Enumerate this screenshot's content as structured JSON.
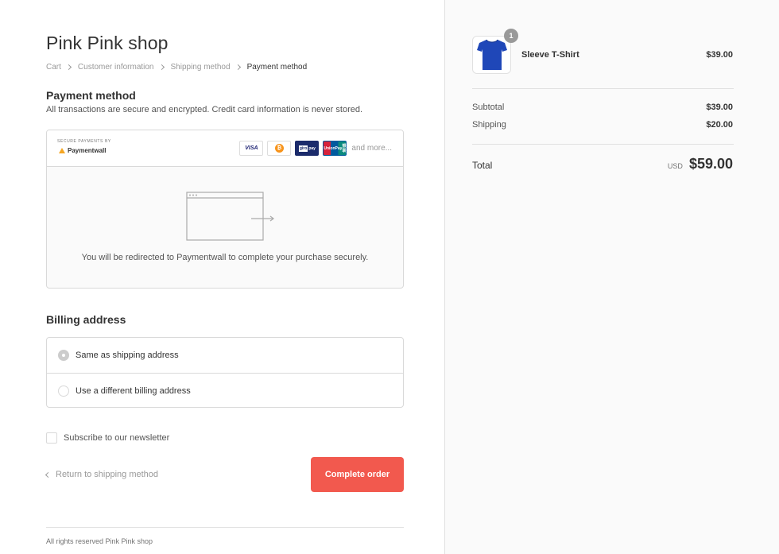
{
  "shop": {
    "title": "Pink Pink shop"
  },
  "breadcrumb": {
    "items": [
      "Cart",
      "Customer information",
      "Shipping method",
      "Payment method"
    ]
  },
  "payment": {
    "title": "Payment method",
    "subtitle": "All transactions are secure and encrypted. Credit card information is never stored.",
    "secure_label": "SECURE PAYMENTS BY",
    "provider_name": "Paymentwall",
    "card_icons": [
      "visa-icon",
      "bitcoin-icon",
      "giropay-icon",
      "unionpay-icon"
    ],
    "card_labels": {
      "visa": "VISA",
      "giro_g": "giro",
      "giro_p": "pay",
      "union_top": "UnionPay",
      "union_bottom": "银联"
    },
    "and_more": "and more...",
    "redirect_text": "You will be redirected to Paymentwall to complete your purchase securely."
  },
  "billing": {
    "title": "Billing address",
    "options": [
      {
        "label": "Same as shipping address",
        "selected": true
      },
      {
        "label": "Use a different billing address",
        "selected": false
      }
    ]
  },
  "newsletter": {
    "label": "Subscribe to our newsletter",
    "checked": false
  },
  "actions": {
    "return_label": "Return to shipping method",
    "complete_label": "Complete order"
  },
  "footer": {
    "text": "All rights reserved Pink Pink shop"
  },
  "order": {
    "items": [
      {
        "name": "Sleeve T-Shirt",
        "quantity": "1",
        "price": "$39.00",
        "thumbnail": "blue-tshirt"
      }
    ],
    "subtotal_label": "Subtotal",
    "subtotal": "$39.00",
    "shipping_label": "Shipping",
    "shipping": "$20.00",
    "total_label": "Total",
    "currency": "USD",
    "total": "$59.00"
  },
  "colors": {
    "accent": "#f2594e",
    "sidebar_bg": "#fafafa",
    "tshirt": "#1f47b8"
  }
}
